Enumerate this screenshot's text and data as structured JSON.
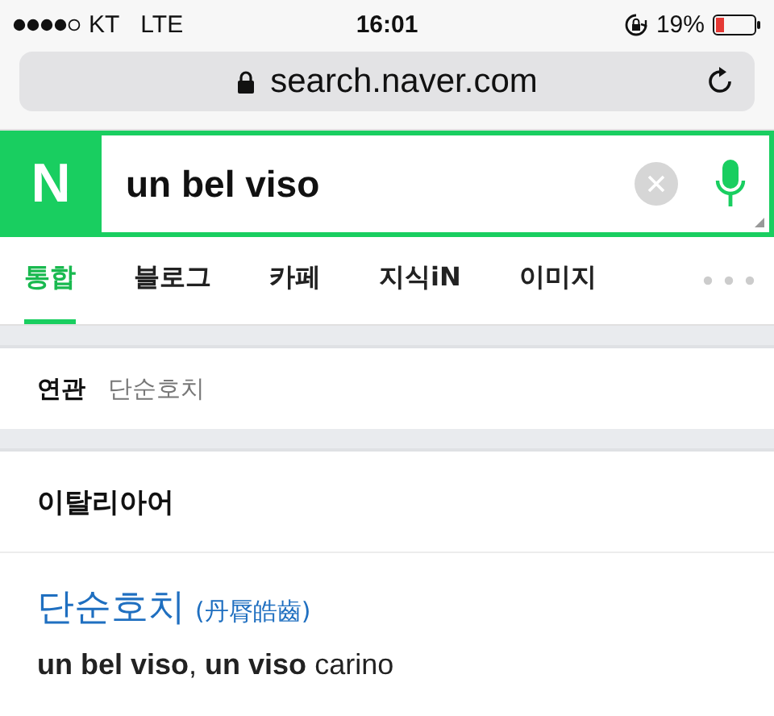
{
  "status_bar": {
    "carrier": "KT",
    "network": "LTE",
    "time": "16:01",
    "battery": "19%"
  },
  "address_bar": {
    "url": "search.naver.com"
  },
  "search": {
    "logo": "N",
    "value": "un bel viso"
  },
  "tabs": [
    {
      "label": "통합",
      "selected": true
    },
    {
      "label": "블로그",
      "selected": false
    },
    {
      "label": "카페",
      "selected": false
    },
    {
      "label": "지식iN",
      "selected": false
    },
    {
      "label": "이미지",
      "selected": false
    }
  ],
  "related": {
    "label": "연관",
    "items": [
      "단순호치"
    ]
  },
  "dictionary": {
    "language": "이탈리아어",
    "entry": {
      "word": "단순호치",
      "hanja": "(丹脣皓齒)",
      "translation": "**un bel viso**, **un viso** carino"
    }
  }
}
